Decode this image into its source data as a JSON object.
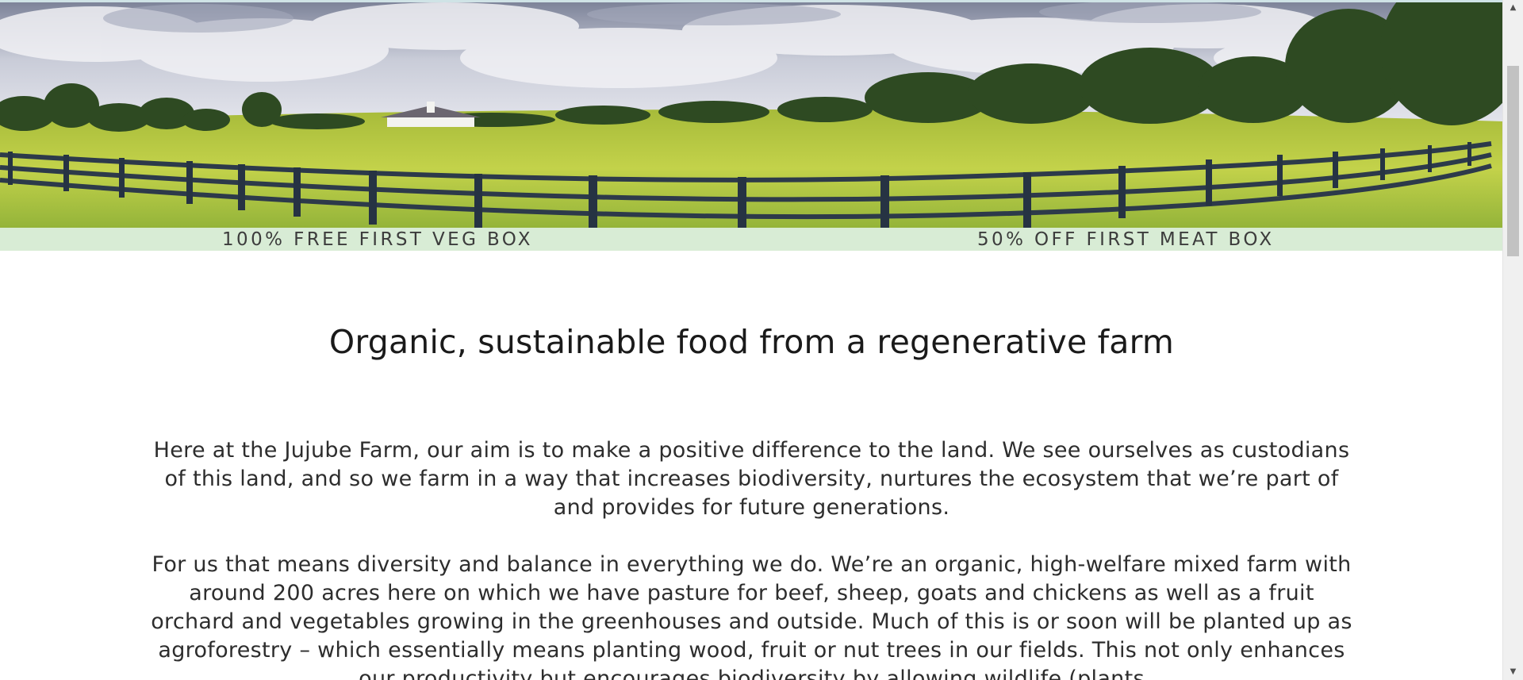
{
  "promo": {
    "left_label": "100% FREE FIRST VEG BOX",
    "right_label": "50% OFF FIRST MEAT BOX"
  },
  "main": {
    "title": "Organic, sustainable food from a regenerative farm",
    "paragraph_1": "Here at the Jujube Farm, our aim is to make a positive difference to the land. We see ourselves as custodians of this land, and so we farm in a way that increases biodiversity, nurtures the ecosystem that we’re part of and provides for future generations.",
    "paragraph_2": "For us that means diversity and balance in everything we do. We’re an organic, high-welfare mixed farm with around 200 acres here on which we have pasture for beef, sheep, goats and chickens as well as a fruit orchard and vegetables growing in the greenhouses and outside. Much of this is or soon will be planted up as agroforestry – which essentially means planting wood, fruit or nut trees in our fields. This not only enhances our productivity but encourages biodiversity by allowing wildlife (plants"
  },
  "scrollbar": {
    "up_icon": "▲",
    "down_icon": "▼"
  },
  "colors": {
    "promo_bar": "#d8ecd5",
    "sky": "#8c93a8",
    "grass": "#b6cc43",
    "fence": "#2d3a4a",
    "trees": "#2e4a22"
  },
  "icons": [
    "hero-farm-image",
    "chevron-up-icon",
    "chevron-down-icon"
  ]
}
